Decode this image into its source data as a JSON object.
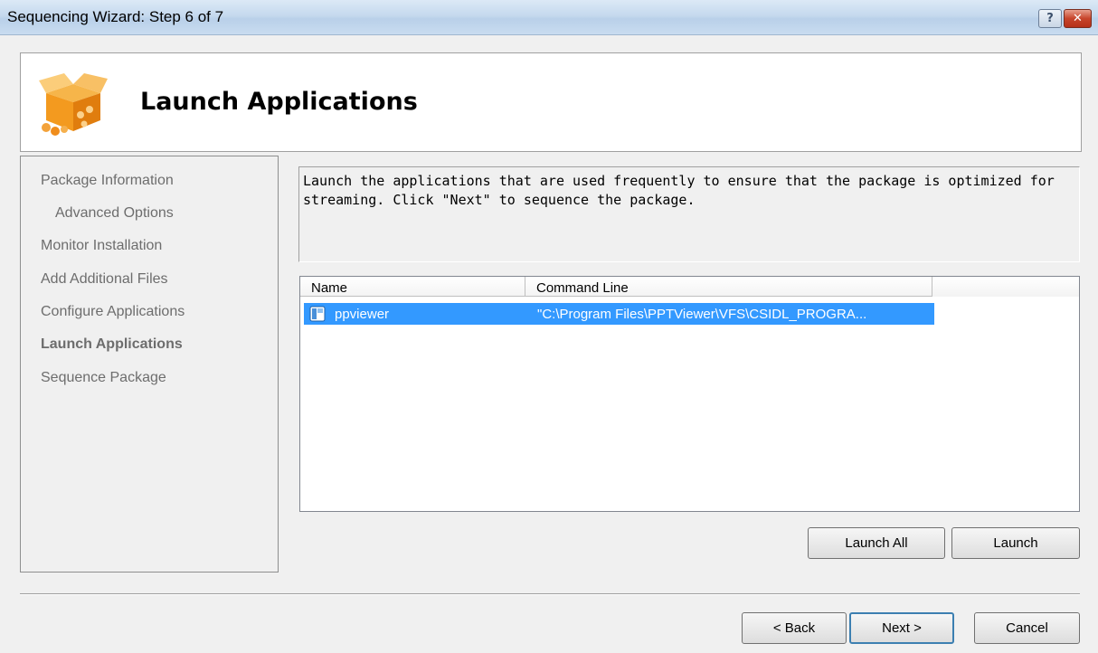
{
  "window": {
    "title": "Sequencing Wizard: Step 6 of 7",
    "help_glyph": "?",
    "close_glyph": "✕"
  },
  "header": {
    "heading": "Launch Applications",
    "icon": "package-box-icon"
  },
  "steps": [
    {
      "label": "Package Information"
    },
    {
      "label": "Advanced Options"
    },
    {
      "label": "Monitor Installation"
    },
    {
      "label": "Add Additional Files"
    },
    {
      "label": "Configure Applications"
    },
    {
      "label": "Launch Applications"
    },
    {
      "label": "Sequence Package"
    }
  ],
  "description": "Launch the applications that are used frequently to ensure that the package is optimized for\nstreaming. Click \"Next\" to sequence the package.",
  "list": {
    "columns": [
      "Name",
      "Command Line"
    ],
    "rows": [
      {
        "name": "ppviewer",
        "command": "\"C:\\Program Files\\PPTViewer\\VFS\\CSIDL_PROGRA...",
        "icon": "application-icon",
        "selected": true
      }
    ]
  },
  "buttons": {
    "launch_all": "Launch All",
    "launch": "Launch",
    "back": "< Back",
    "next": "Next >",
    "cancel": "Cancel"
  },
  "colors": {
    "selection": "#3399ff",
    "accent": "#3c7fb1"
  }
}
